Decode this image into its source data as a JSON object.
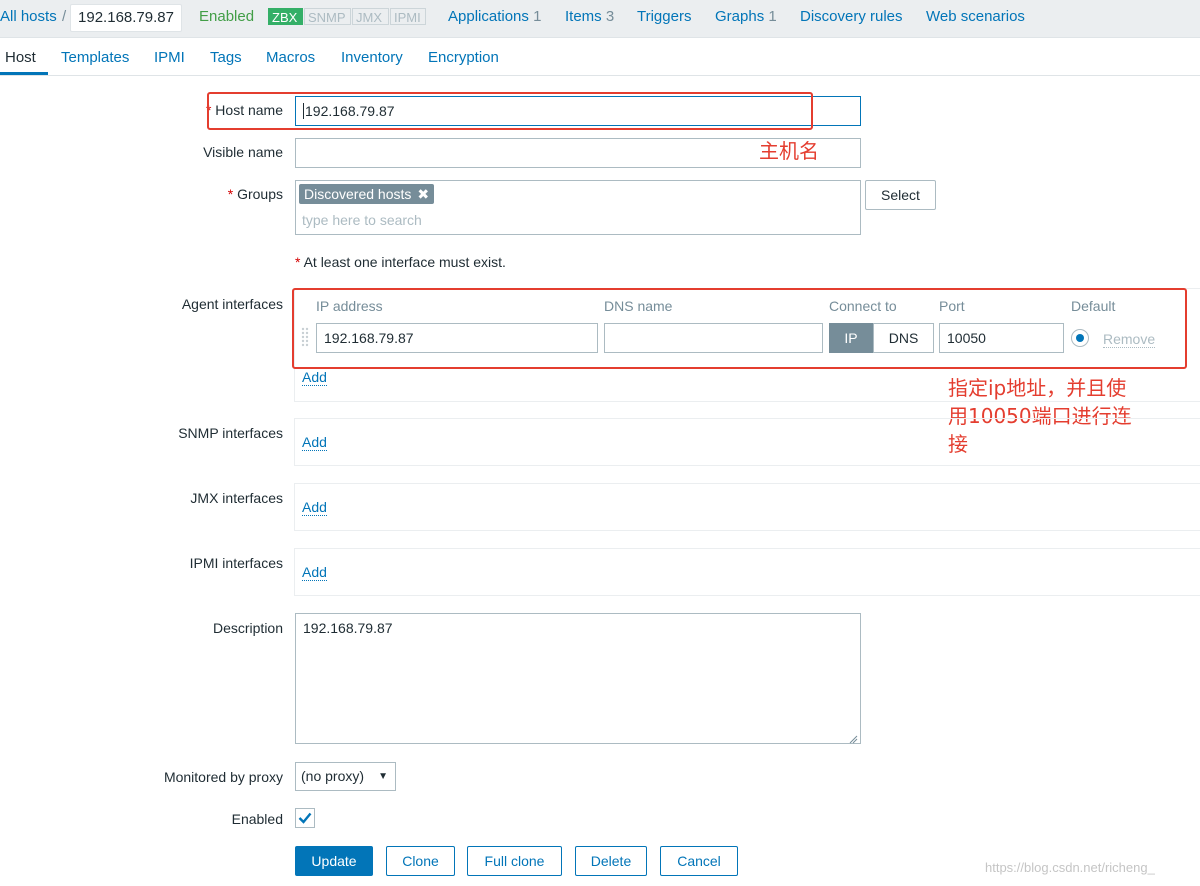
{
  "breadcrumb": {
    "all_hosts": "All hosts",
    "separator": "/",
    "host": "192.168.79.87",
    "status": "Enabled"
  },
  "availability": [
    "ZBX",
    "SNMP",
    "JMX",
    "IPMI"
  ],
  "nav": {
    "applications": "Applications",
    "applications_count": "1",
    "items": "Items",
    "items_count": "3",
    "triggers": "Triggers",
    "graphs": "Graphs",
    "graphs_count": "1",
    "discovery_rules": "Discovery rules",
    "web_scenarios": "Web scenarios"
  },
  "tabs": [
    "Host",
    "Templates",
    "IPMI",
    "Tags",
    "Macros",
    "Inventory",
    "Encryption"
  ],
  "form": {
    "host_name_label": "Host name",
    "host_name_value": "192.168.79.87",
    "visible_name_label": "Visible name",
    "groups_label": "Groups",
    "group_tag": "Discovered hosts",
    "group_remove": "✖",
    "groups_placeholder": "type here to search",
    "select_button": "Select",
    "interface_note": "At least one interface must exist.",
    "agent_interfaces_label": "Agent interfaces",
    "col_ip": "IP address",
    "col_dns": "DNS name",
    "col_connect": "Connect to",
    "col_port": "Port",
    "col_default": "Default",
    "ip_value": "192.168.79.87",
    "dns_value": "",
    "connect_ip": "IP",
    "connect_dns": "DNS",
    "port_value": "10050",
    "remove": "Remove",
    "add": "Add",
    "snmp_label": "SNMP interfaces",
    "jmx_label": "JMX interfaces",
    "ipmi_label": "IPMI interfaces",
    "description_label": "Description",
    "description_value": "192.168.79.87",
    "proxy_label": "Monitored by proxy",
    "proxy_value": "(no proxy)",
    "enabled_label": "Enabled",
    "enabled_checked": true
  },
  "actions": {
    "update": "Update",
    "clone": "Clone",
    "full_clone": "Full clone",
    "delete": "Delete",
    "cancel": "Cancel"
  },
  "annotations": {
    "host_name_note": "主机名",
    "interface_note_line1": "指定ip地址，并且使",
    "interface_note_line2": "用10050端口进行连",
    "interface_note_line3": "接"
  },
  "watermark": "https://blog.csdn.net/richeng_",
  "colors": {
    "accent": "#0275b8",
    "enabled_green": "#429e47",
    "zbx_green": "#34af67",
    "annotation_red": "#e43d2f"
  }
}
